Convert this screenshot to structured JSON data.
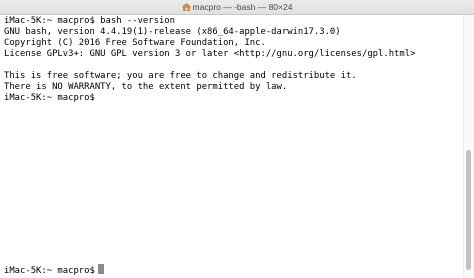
{
  "window": {
    "title": "macpro — -bash — 80×24"
  },
  "terminal": {
    "lines": [
      "iMac-5K:~ macpro$ bash --version",
      "GNU bash, version 4.4.19(1)-release (x86_64-apple-darwin17.3.0)",
      "Copyright (C) 2016 Free Software Foundation, Inc.",
      "License GPLv3+: GNU GPL version 3 or later <http://gnu.org/licenses/gpl.html>",
      "",
      "This is free software; you are free to change and redistribute it.",
      "There is NO WARRANTY, to the extent permitted by law.",
      "iMac-5K:~ macpro$"
    ],
    "current_prompt": "iMac-5K:~ macpro$"
  },
  "icons": {
    "title_icon": "home-folder-icon"
  }
}
